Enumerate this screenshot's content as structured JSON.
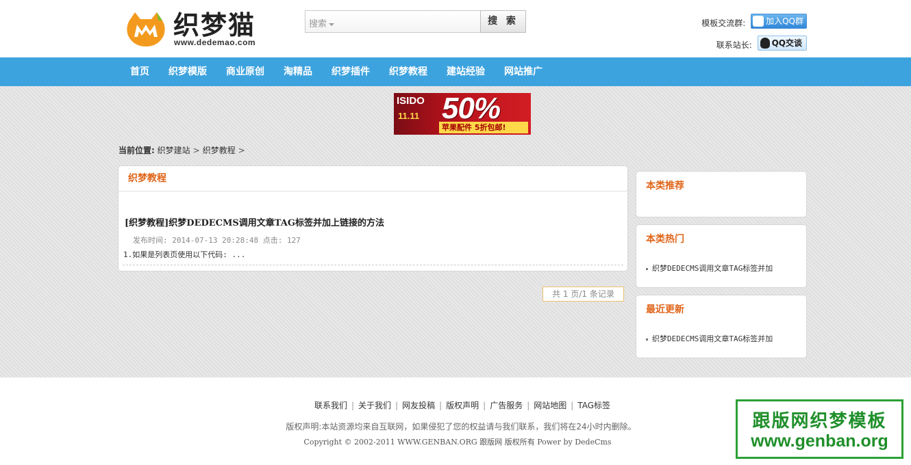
{
  "header": {
    "logo_text": "织梦猫",
    "logo_url": "www.dedemao.com",
    "search_placeholder": "搜索",
    "search_button": "搜 索",
    "group_label": "模板交流群:",
    "group_button": "加入QQ群",
    "admin_label": "联系站长:",
    "admin_button": "QQ交谈"
  },
  "nav": {
    "items": [
      "首页",
      "织梦模版",
      "商业原创",
      "淘精品",
      "织梦插件",
      "织梦教程",
      "建站经验",
      "网站推广"
    ]
  },
  "banner": {
    "brand": "ISIDO",
    "date": "11.11",
    "discount": "50%",
    "promo": "苹果配件 5折包邮!"
  },
  "breadcrumb": {
    "label": "当前位置:",
    "items": [
      "织梦建站",
      "织梦教程"
    ]
  },
  "list": {
    "heading": "织梦教程",
    "articles": [
      {
        "title": "[织梦教程]织梦DEDECMS调用文章TAG标签并加上链接的方法",
        "meta": "发布时间: 2014-07-13 20:28:48 点击: 127",
        "desc": "1.如果是列表页使用以下代码: ..."
      }
    ],
    "pager": "共 1 页/1 条记录"
  },
  "sidebar": {
    "recommend": {
      "heading": "本类推荐"
    },
    "hot": {
      "heading": "本类热门",
      "items": [
        "织梦DEDECMS调用文章TAG标签并加"
      ]
    },
    "latest": {
      "heading": "最近更新",
      "items": [
        "织梦DEDECMS调用文章TAG标签并加"
      ]
    }
  },
  "footer": {
    "links": [
      "联系我们",
      "关于我们",
      "网友投稿",
      "版权声明",
      "广告服务",
      "网站地图",
      "TAG标签"
    ],
    "notice": "版权声明:本站资源均来自互联网，如果侵犯了您的权益请与我们联系，我们将在24小时内删除。",
    "copyright": "Copyright © 2002-2011 WWW.GENBAN.ORG 跟版网 版权所有 Power by DedeCms"
  },
  "watermark": {
    "line1": "跟版网织梦模板",
    "line2": "www.genban.org"
  },
  "colors": {
    "nav_bg": "#3da3df",
    "accent": "#e0651a",
    "logo_orange": "#f39a1e"
  }
}
